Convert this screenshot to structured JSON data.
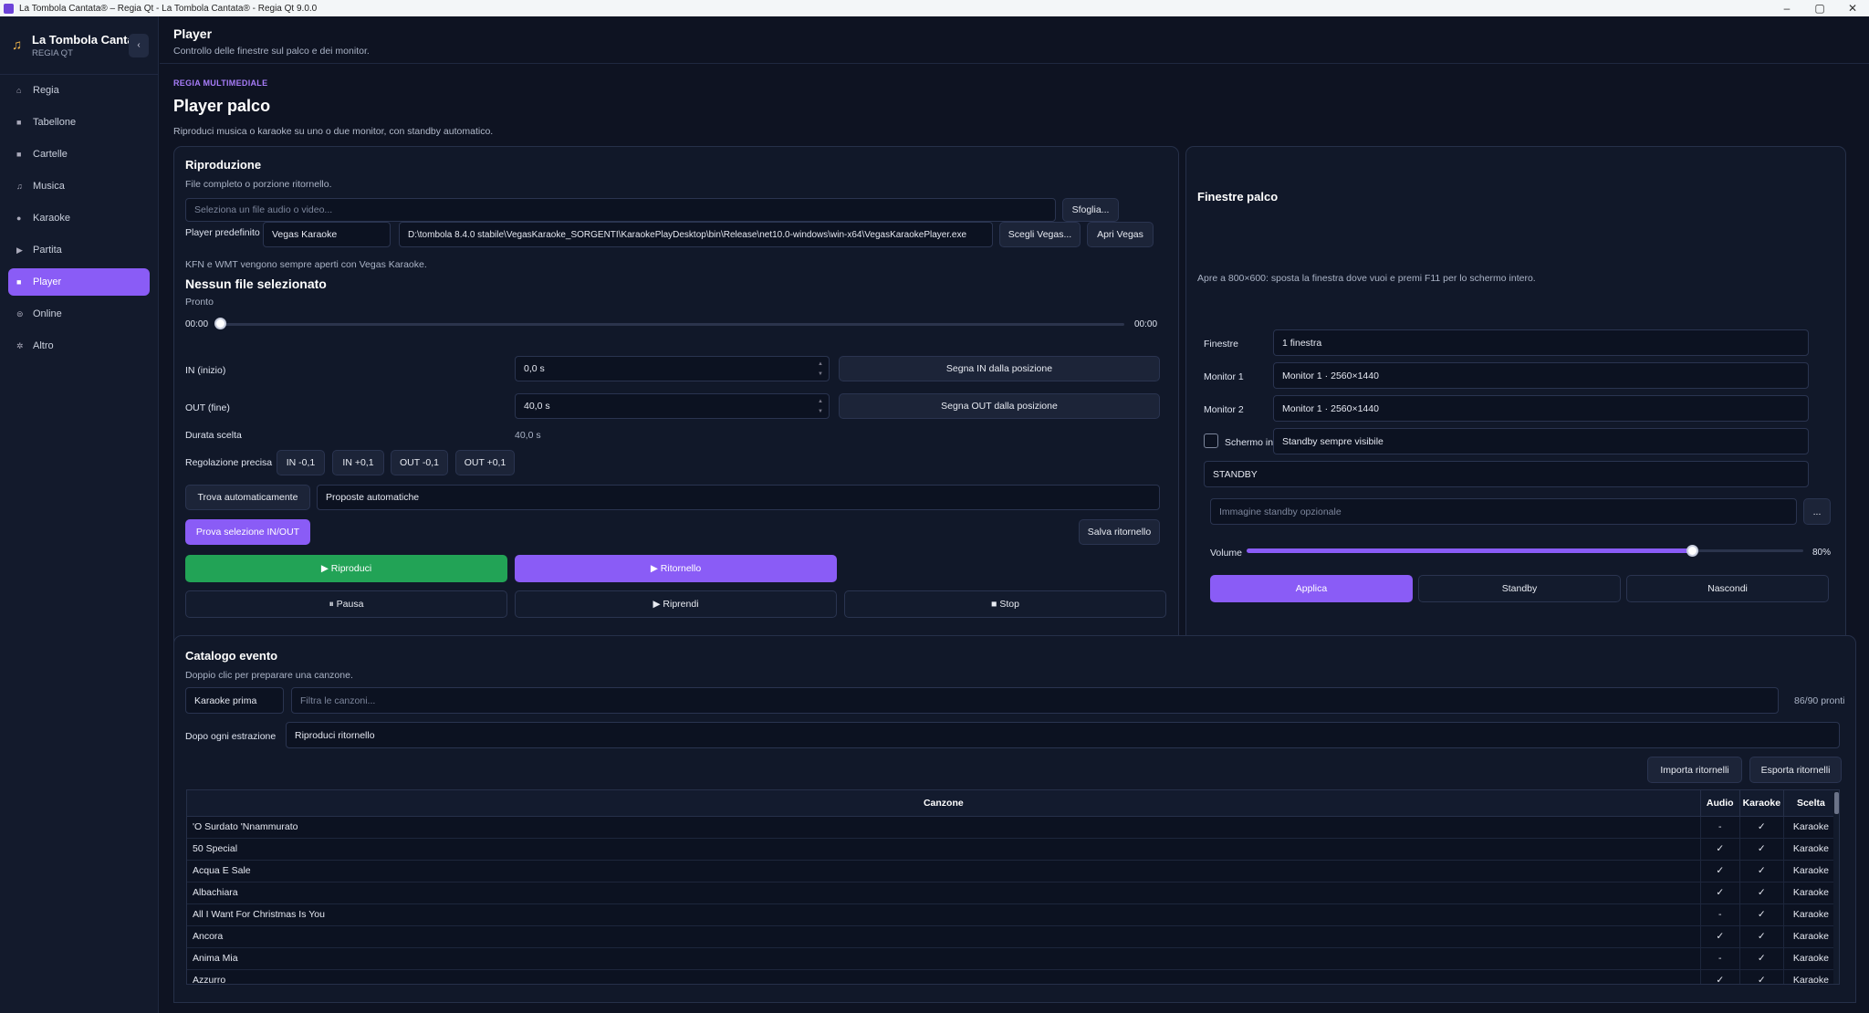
{
  "window": {
    "title": "La Tombola Cantata® – Regia Qt - La Tombola Cantata® - Regia Qt 9.0.0",
    "controls": [
      "–",
      "▢",
      "✕"
    ]
  },
  "sidebar": {
    "brand_name": "La Tombola Cantata",
    "brand_sub": "REGIA QT",
    "collapse_glyph": "‹",
    "items": [
      {
        "label": "Regia",
        "icon": "⌂"
      },
      {
        "label": "Tabellone",
        "icon": "■"
      },
      {
        "label": "Cartelle",
        "icon": "■"
      },
      {
        "label": "Musica",
        "icon": "♫"
      },
      {
        "label": "Karaoke",
        "icon": "●"
      },
      {
        "label": "Partita",
        "icon": "▶"
      },
      {
        "label": "Player",
        "icon": "■",
        "active": true
      },
      {
        "label": "Online",
        "icon": "⊜"
      },
      {
        "label": "Altro",
        "icon": "✲"
      }
    ]
  },
  "header": {
    "title": "Player",
    "subtitle": "Controllo delle finestre sul palco e dei monitor."
  },
  "page": {
    "eyebrow": "REGIA MULTIMEDIALE",
    "title": "Player palco",
    "description": "Riproduci musica o karaoke su uno o due monitor, con standby automatico."
  },
  "playback": {
    "title": "Riproduzione",
    "subtitle": "File completo o porzione ritornello.",
    "file_placeholder": "Seleziona un file audio o video...",
    "browse_label": "Sfoglia...",
    "default_player_label": "Player predefinito",
    "default_player_value": "Vegas Karaoke",
    "player_path": "D:\\tombola 8.4.0 stabile\\VegasKaraoke_SORGENTI\\KaraokePlayDesktop\\bin\\Release\\net10.0-windows\\win-x64\\VegasKaraokePlayer.exe",
    "choose_vegas_label": "Scegli Vegas...",
    "open_vegas_label": "Apri Vegas",
    "kfn_note": "KFN e WMT vengono sempre aperti con Vegas Karaoke.",
    "no_file": "Nessun file selezionato",
    "status": "Pronto",
    "time_start": "00:00",
    "time_end": "00:00",
    "position_fraction": 0.0,
    "in_label": "IN (inizio)",
    "in_value": "0,0 s",
    "mark_in_label": "Segna IN dalla posizione",
    "out_label": "OUT (fine)",
    "out_value": "40,0 s",
    "mark_out_label": "Segna OUT dalla posizione",
    "duration_label": "Durata scelta",
    "duration_value": "40,0 s",
    "fine_label": "Regolazione precisa",
    "fine_buttons": [
      "IN -0,1",
      "IN +0,1",
      "OUT -0,1",
      "OUT +0,1"
    ],
    "auto_find_label": "Trova automaticamente",
    "auto_proposals": "Proposte automatiche",
    "test_label": "Prova selezione IN/OUT",
    "save_chorus_label": "Salva ritornello",
    "play_label": "▶ Riproduci",
    "chorus_label": "▶ Ritornello",
    "pause_label": "⏸ Pausa",
    "resume_label": "▶ Riprendi",
    "stop_label": "■ Stop"
  },
  "stage": {
    "title": "Finestre palco",
    "hint": "Apre a 800×600: sposta la finestra dove vuoi e premi F11 per lo schermo intero.",
    "windows_label": "Finestre",
    "windows_value": "1 finestra",
    "monitor1_label": "Monitor 1",
    "monitor1_value": "Monitor 1 · 2560×1440",
    "monitor2_label": "Monitor 2",
    "monitor2_value": "Monitor 1 · 2560×1440",
    "fullscreen_label": "Schermo intero",
    "fullscreen_checked": false,
    "standby_mode": "Standby sempre visibile",
    "standby_text": "STANDBY",
    "standby_image_placeholder": "Immagine standby opzionale",
    "standby_image_browse": "...",
    "volume_label": "Volume",
    "volume_value": "80%",
    "volume_fraction": 0.8,
    "apply_label": "Applica",
    "standby_label": "Standby",
    "hide_label": "Nascondi"
  },
  "catalog": {
    "title": "Catalogo evento",
    "subtitle": "Doppio clic per preparare una canzone.",
    "mode_value": "Karaoke prima",
    "filter_placeholder": "Filtra le canzoni...",
    "ready_count": "86/90 pronti",
    "after_label": "Dopo ogni estrazione",
    "after_value": "Riproduci ritornello",
    "import_label": "Importa ritornelli",
    "export_label": "Esporta ritornelli",
    "columns": [
      "Canzone",
      "Audio",
      "Karaoke",
      "Scelta"
    ],
    "rows": [
      [
        "'O Surdato 'Nnammurato",
        "-",
        "✓",
        "Karaoke"
      ],
      [
        "50 Special",
        "✓",
        "✓",
        "Karaoke"
      ],
      [
        "Acqua E Sale",
        "✓",
        "✓",
        "Karaoke"
      ],
      [
        "Albachiara",
        "✓",
        "✓",
        "Karaoke"
      ],
      [
        "All I Want For Christmas Is You",
        "-",
        "✓",
        "Karaoke"
      ],
      [
        "Ancora",
        "✓",
        "✓",
        "Karaoke"
      ],
      [
        "Anima Mia",
        "-",
        "✓",
        "Karaoke"
      ],
      [
        "Azzurro",
        "✓",
        "✓",
        "Karaoke"
      ]
    ]
  }
}
